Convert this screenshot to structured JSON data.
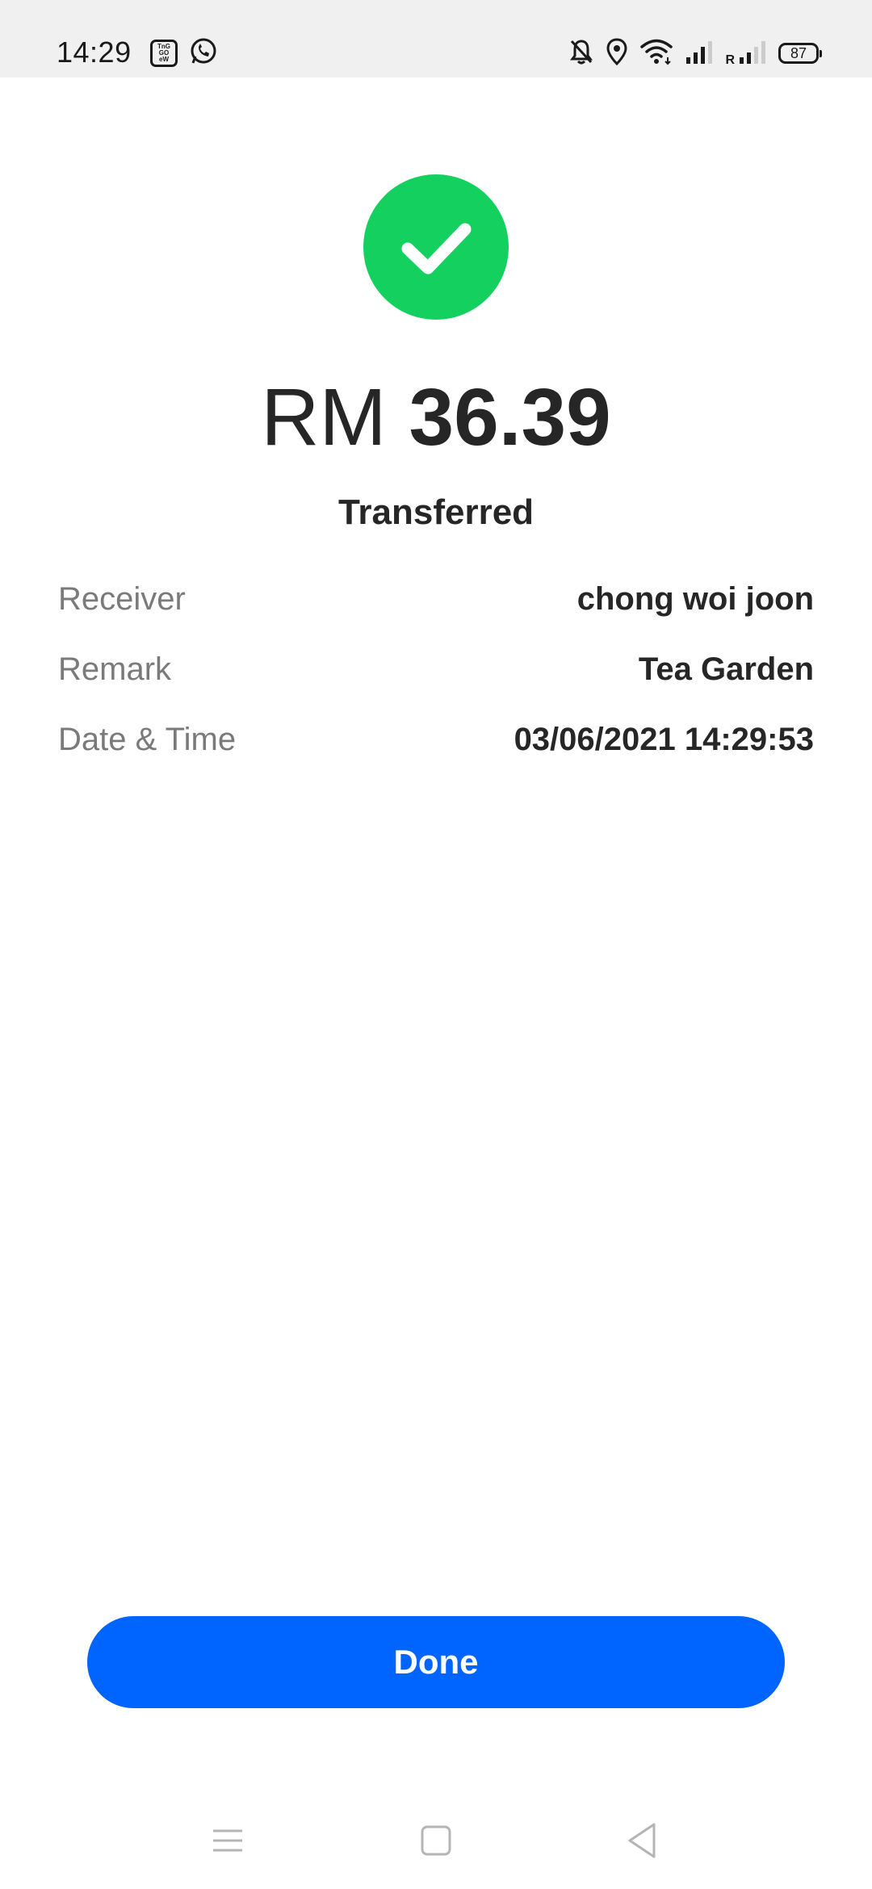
{
  "status_bar": {
    "time": "14:29",
    "battery": "87",
    "signal_label": "R"
  },
  "result": {
    "currency": "RM",
    "amount": "36.39",
    "status": "Transferred"
  },
  "details": [
    {
      "label": "Receiver",
      "value": "chong woi joon"
    },
    {
      "label": "Remark",
      "value": "Tea Garden"
    },
    {
      "label": "Date & Time",
      "value": "03/06/2021 14:29:53"
    }
  ],
  "done_button": {
    "label": "Done"
  },
  "colors": {
    "success_green": "#13d05f",
    "primary_blue": "#0065fe",
    "text_dark": "#262626",
    "text_muted": "#7a7a7a"
  }
}
